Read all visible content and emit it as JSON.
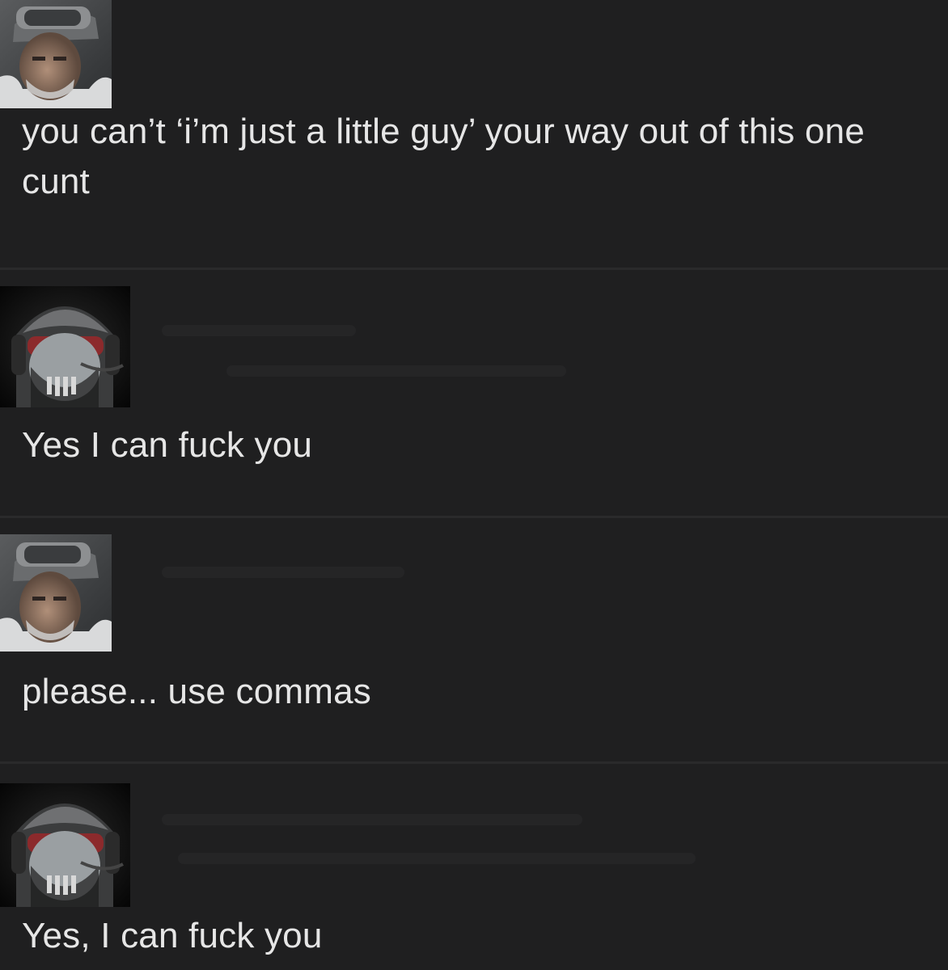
{
  "thread": {
    "posts": [
      {
        "avatar_icon": "soap-avatar",
        "text": "you can’t ‘i’m just a little guy’ your way out of this one cunt"
      },
      {
        "avatar_icon": "ghost-avatar",
        "text": "Yes I can fuck you"
      },
      {
        "avatar_icon": "soap-avatar",
        "text": "please... use commas"
      },
      {
        "avatar_icon": "ghost-avatar",
        "text": "Yes, I can fuck you"
      }
    ]
  },
  "colors": {
    "background": "#1f1f20",
    "divider": "#2a2a2b",
    "text": "#e6e6e6"
  }
}
